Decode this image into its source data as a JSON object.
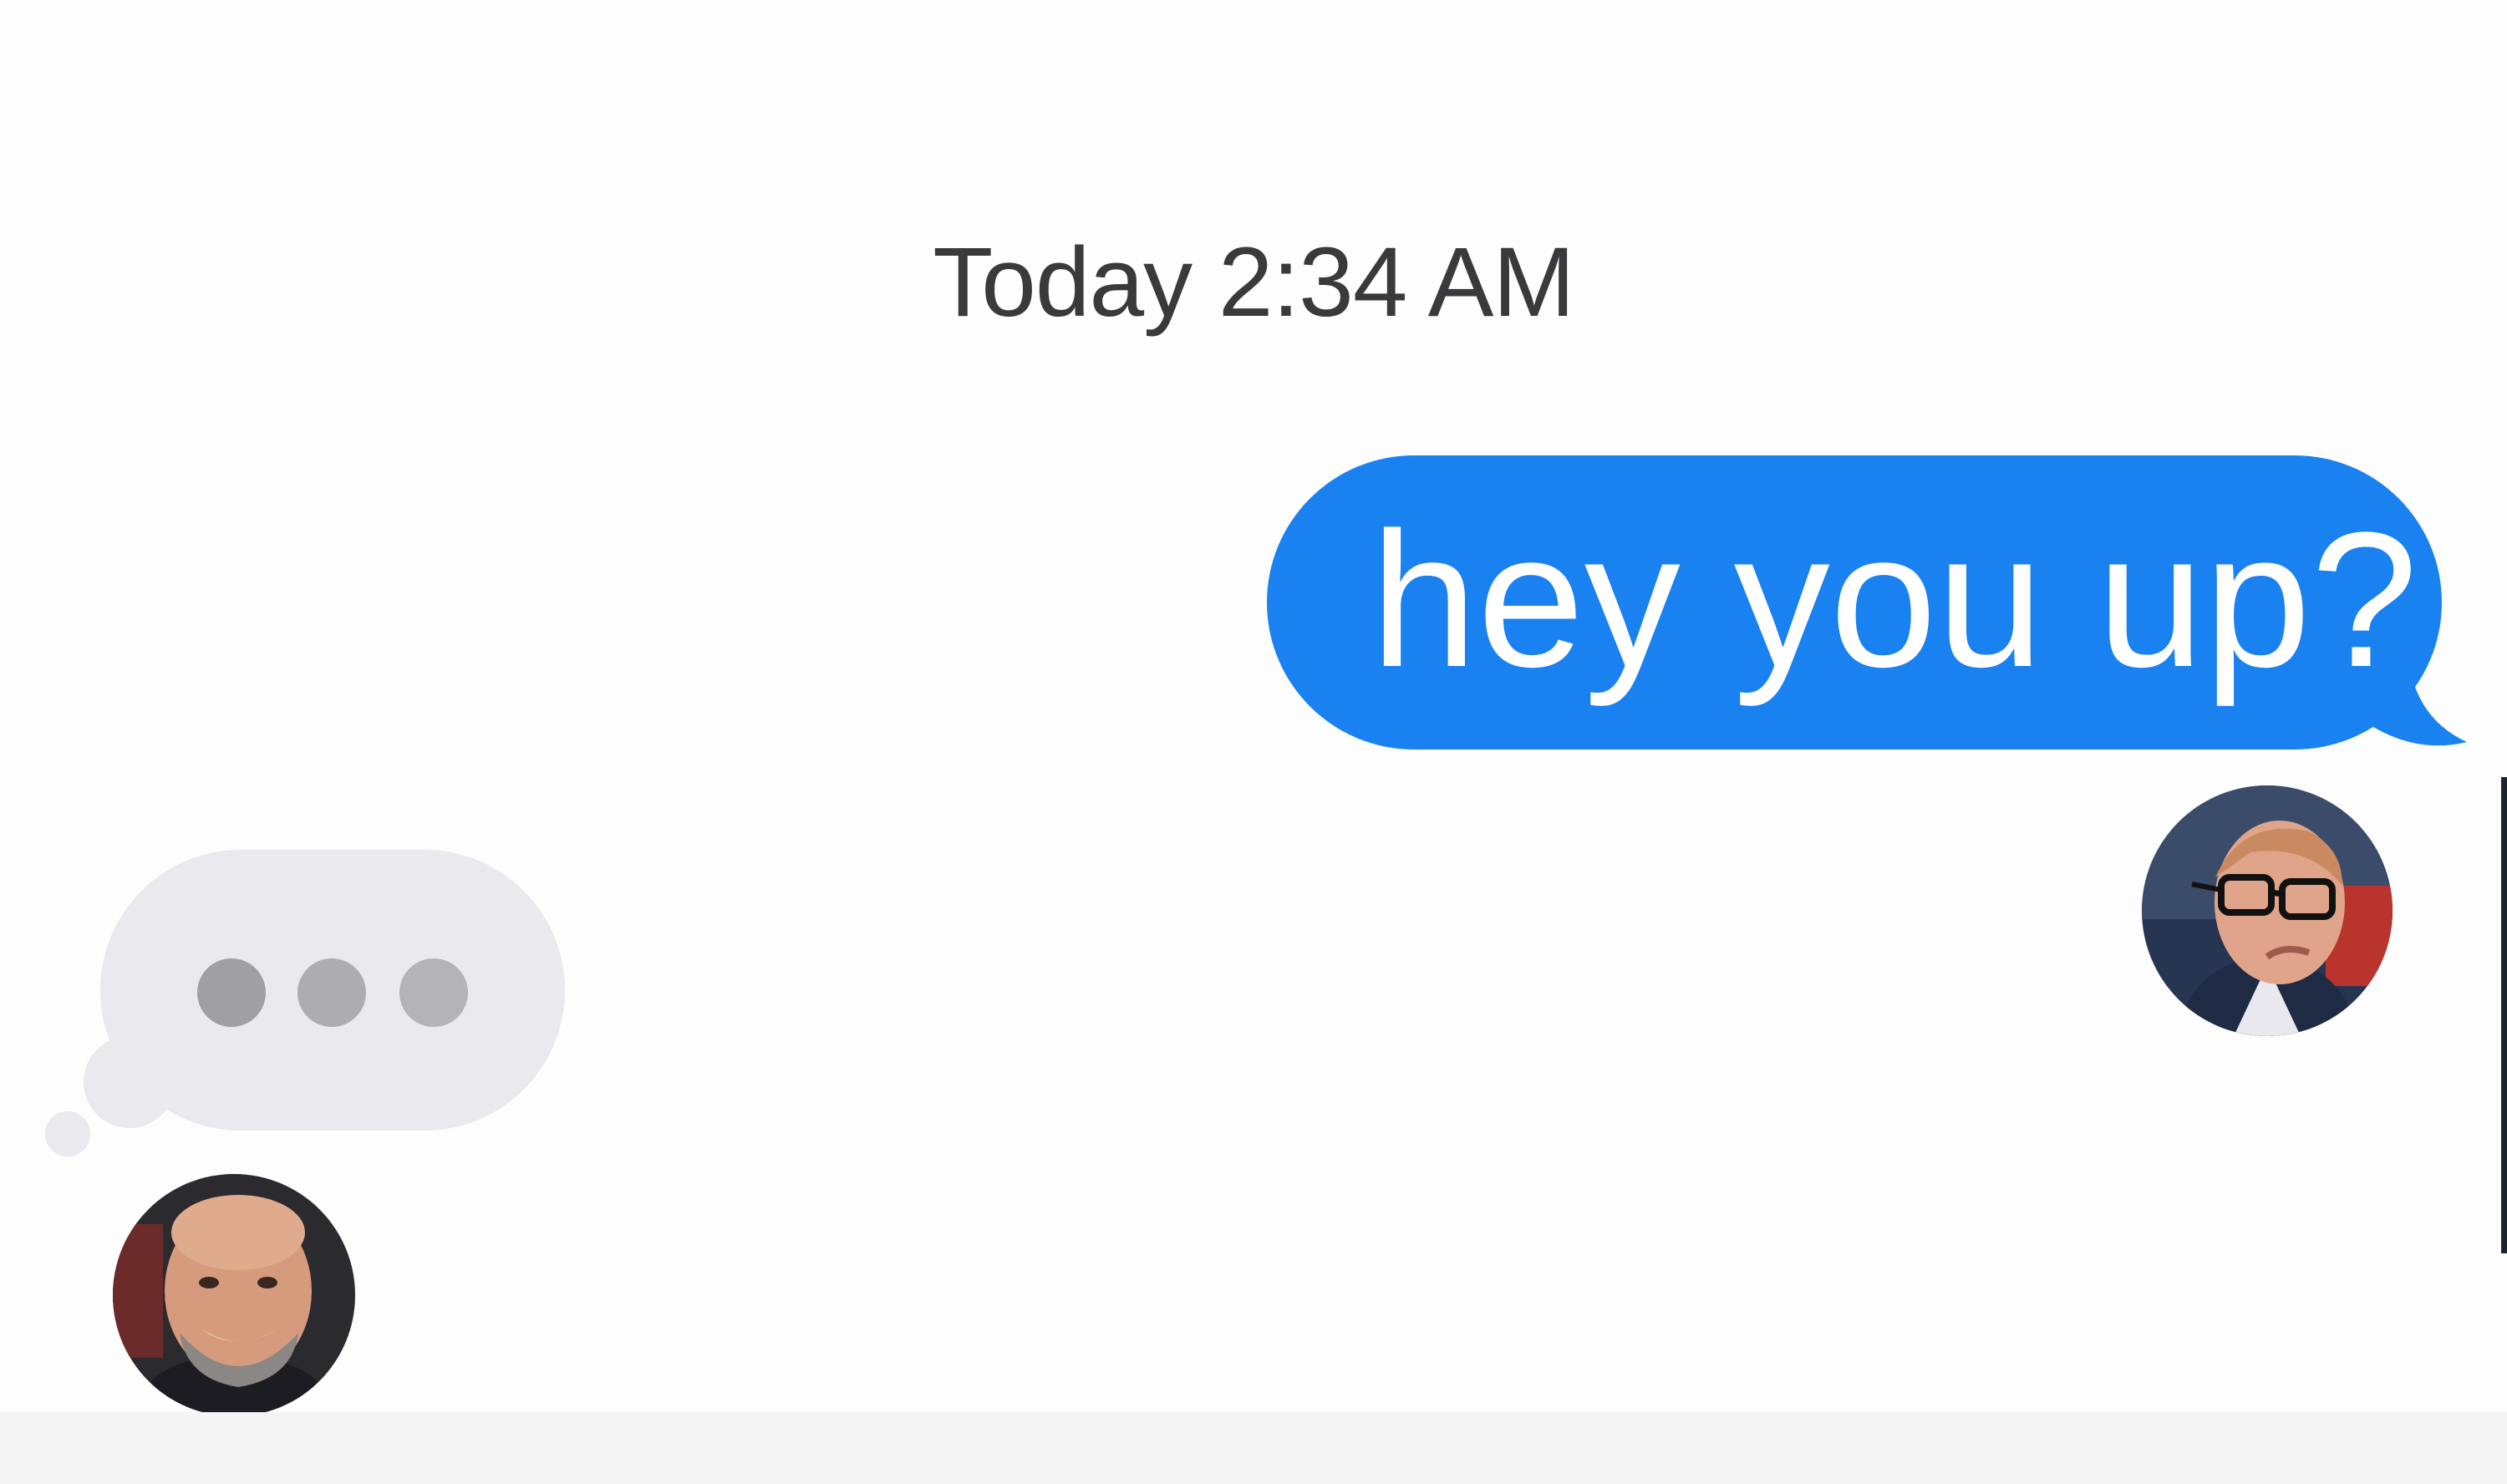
{
  "conversation": {
    "timestamp": "Today 2:34 AM",
    "outgoing_message": "hey you up?",
    "typing_indicator": "typing",
    "colors": {
      "outgoing_bubble": "#1a82f0",
      "incoming_bubble": "#e9e9ee",
      "timestamp_text": "#3a3a3c"
    },
    "icons": {
      "typing": "ellipsis-dots",
      "sender_avatar": "avatar-photo-man-glasses",
      "recipient_avatar": "avatar-photo-man-beard"
    }
  }
}
